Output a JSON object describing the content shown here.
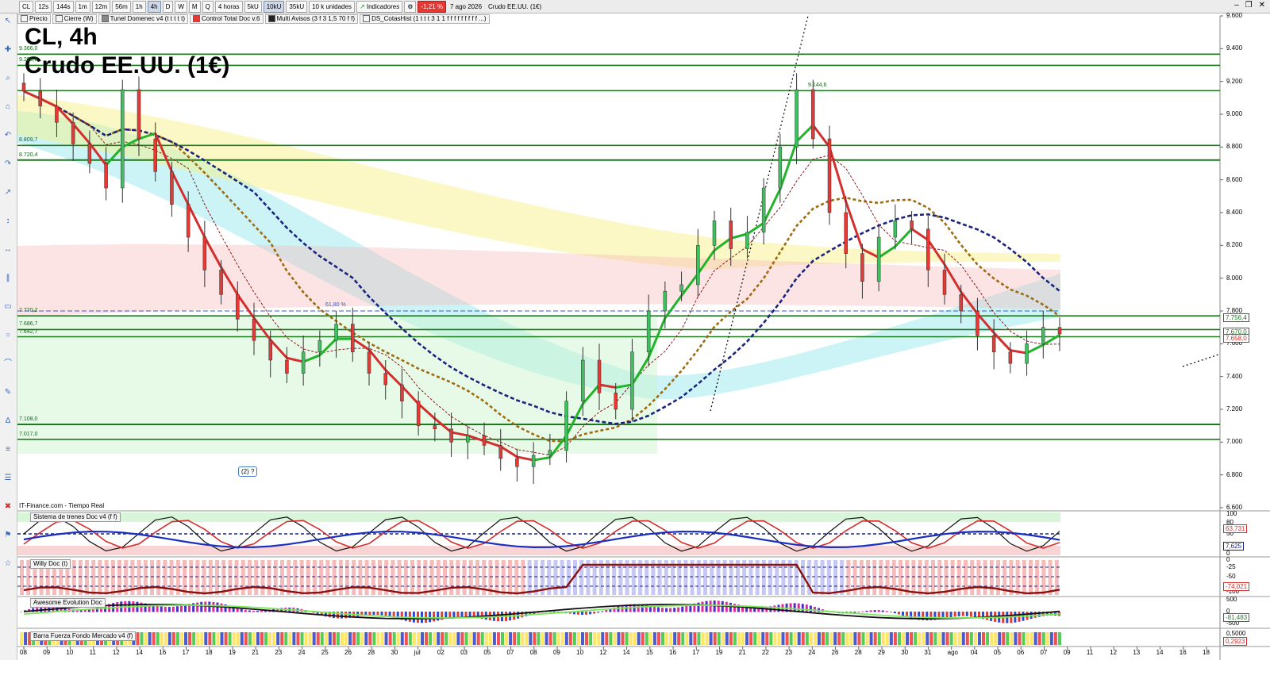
{
  "toolbar": {
    "symbol": "CL",
    "timeframes": [
      "12s",
      "144s",
      "1m",
      "12m",
      "56m",
      "1h",
      "4h",
      "D",
      "W",
      "M",
      "Q"
    ],
    "active_timeframe": "4h",
    "period": "4 horas",
    "tick_buttons": [
      "5kU",
      "10kU",
      "35kU"
    ],
    "active_tick": "10kU",
    "units": "10 k unidades",
    "indicators_label": "Indicadores",
    "change": "-1,21 %",
    "date": "7 ago 2026",
    "instrument": "Crudo EE.UU. (1€)"
  },
  "indicators": [
    "Precio",
    "Cierre (W)",
    "Tunel Domenec v4 (t t t t t)",
    "Control Total Doc v.6",
    "Multi Avisos (3 f 3 1,5 70 f f)",
    "DS_CotasHist (1 t t t 3 1 1 f f f f f f f f f ...)"
  ],
  "colors": {
    "bull": "#3fbf5f",
    "bear": "#e53935",
    "level": "#1b7a1b",
    "ema_fast": "#22b32a",
    "ema_red": "#d32f2f",
    "ema_dashed": "#9c6b12",
    "ema_blue": "#1a237e"
  },
  "title": {
    "symbol": "CL, 4h",
    "name": "Crudo EE.UU. (1€)"
  },
  "source_label": "IT-Finance.com - Tiempo Real",
  "note_label": "(2) ?",
  "fib_label": "61,80 %",
  "level_labels": [
    "9.366,0",
    "9.298,0",
    "8.809,7",
    "8.720,4",
    "7.770,2",
    "7.686,7",
    "7.642,7",
    "7.108,0",
    "7.017,0"
  ],
  "extra_label": "9.144,6",
  "price_tags": [
    {
      "value": "7.756,4",
      "color": "#1b7a1b"
    },
    {
      "value": "7.670,0",
      "color": "#1b7a1b"
    },
    {
      "value": "7.658,0",
      "color": "#d32f2f"
    }
  ],
  "panes": {
    "p1": {
      "title": "Sistema de trenes Doc v4 (f f)",
      "ticks": [
        "100",
        "80",
        "50",
        "20",
        "0"
      ],
      "tags": [
        "63,731",
        "7,625"
      ]
    },
    "p2": {
      "title": "Willy Doc (t)",
      "ticks": [
        "0",
        "-25",
        "-50",
        "-75",
        "-100"
      ],
      "tags": [
        "-74,021"
      ]
    },
    "p3": {
      "title": "Awesome Evolution Doc",
      "ticks": [
        "500",
        "0",
        "-500"
      ],
      "tags": [
        "-81,483"
      ]
    },
    "p4": {
      "title": "Barra Fuerza Fondo Mercado v4 (f)",
      "ticks": [
        "0,5000",
        "0,0000"
      ],
      "tags": [
        "0,2923"
      ]
    }
  },
  "chart_data": {
    "type": "candlestick",
    "title": "CL, 4h",
    "subtitle": "Crudo EE.UU. (1€)",
    "ylim": [
      6.6,
      9.6
    ],
    "y_ticks": [
      "9.600",
      "9.400",
      "9.200",
      "9.000",
      "8.800",
      "8.600",
      "8.400",
      "8.200",
      "8.000",
      "7.800",
      "7.600",
      "7.400",
      "7.200",
      "7.000",
      "6.800",
      "6.600"
    ],
    "x_ticks": [
      "08",
      "09",
      "10",
      "11",
      "12",
      "14",
      "16",
      "17",
      "18",
      "19",
      "21",
      "23",
      "24",
      "25",
      "26",
      "28",
      "30",
      "jul",
      "02",
      "03",
      "05",
      "07",
      "08",
      "09",
      "10",
      "12",
      "14",
      "15",
      "16",
      "17",
      "19",
      "21",
      "22",
      "23",
      "24",
      "26",
      "28",
      "29",
      "30",
      "31",
      "ago",
      "04",
      "05",
      "06",
      "07",
      "09",
      "11",
      "12",
      "13",
      "14",
      "16",
      "18"
    ],
    "close_path": [
      9.14,
      9.05,
      8.95,
      8.82,
      8.7,
      8.55,
      9.15,
      8.85,
      8.65,
      8.45,
      8.25,
      8.05,
      7.9,
      7.75,
      7.62,
      7.5,
      7.42,
      7.55,
      7.62,
      7.72,
      7.55,
      7.42,
      7.35,
      7.25,
      7.1,
      7.08,
      7.0,
      7.04,
      6.98,
      6.9,
      6.85,
      6.92,
      6.95,
      7.25,
      7.5,
      7.3,
      7.2,
      7.55,
      7.8,
      7.92,
      7.96,
      8.2,
      8.35,
      8.18,
      8.28,
      8.55,
      8.8,
      9.15,
      8.85,
      8.4,
      8.15,
      7.98,
      8.25,
      8.35,
      8.3,
      8.05,
      7.9,
      7.8,
      7.65,
      7.55,
      7.48,
      7.6,
      7.7,
      7.66
    ],
    "horizontal_levels": [
      9.366,
      9.298,
      9.144,
      8.8097,
      8.7204,
      7.7702,
      7.6867,
      7.6427,
      7.108,
      7.017
    ],
    "current_price": 7.658,
    "change_pct": -1.21,
    "grid": false
  }
}
